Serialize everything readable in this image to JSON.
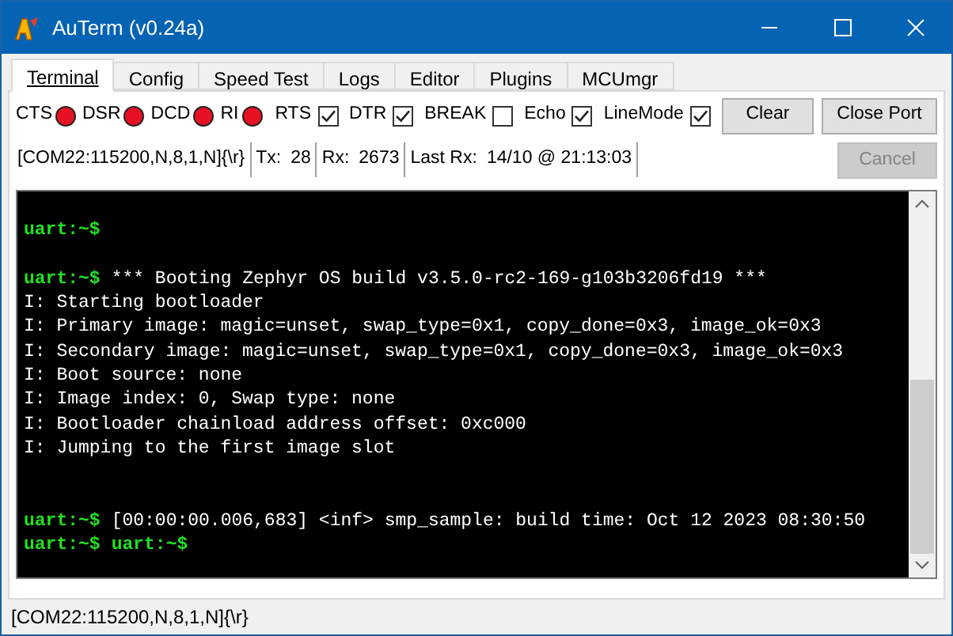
{
  "window": {
    "title": "AuTerm (v0.24a)"
  },
  "tabs": [
    {
      "label": "Terminal",
      "selected": true
    },
    {
      "label": "Config",
      "selected": false
    },
    {
      "label": "Speed Test",
      "selected": false
    },
    {
      "label": "Logs",
      "selected": false
    },
    {
      "label": "Editor",
      "selected": false
    },
    {
      "label": "Plugins",
      "selected": false
    },
    {
      "label": "MCUmgr",
      "selected": false
    }
  ],
  "indicators": [
    {
      "label": "CTS",
      "color": "#e81123"
    },
    {
      "label": "DSR",
      "color": "#e81123"
    },
    {
      "label": "DCD",
      "color": "#e81123"
    },
    {
      "label": "RI",
      "color": "#e81123"
    }
  ],
  "checkboxes": [
    {
      "label": "RTS",
      "checked": true
    },
    {
      "label": "DTR",
      "checked": true
    },
    {
      "label": "BREAK",
      "checked": false
    },
    {
      "label": "Echo",
      "checked": true
    },
    {
      "label": "LineMode",
      "checked": true
    }
  ],
  "buttons": [
    {
      "label": "Clear",
      "disabled": false
    },
    {
      "label": "Close Port",
      "disabled": false
    }
  ],
  "info_bar": [
    {
      "kind": "value",
      "text": "[COM22:115200,N,8,1,N]{\\r}"
    },
    {
      "kind": "label",
      "text": "Tx:"
    },
    {
      "kind": "value",
      "text": "28"
    },
    {
      "kind": "label",
      "text": "Rx:"
    },
    {
      "kind": "value",
      "text": "2673"
    },
    {
      "kind": "label",
      "text": "Last Rx:"
    },
    {
      "kind": "value",
      "text": "14/10 @ 21:13:03"
    }
  ],
  "cancel_button": {
    "label": "Cancel",
    "disabled": true
  },
  "terminal": [
    {
      "kind": "blank"
    },
    {
      "kind": "line",
      "segments": [
        {
          "kind": "prompt",
          "text": "uart:~$"
        }
      ]
    },
    {
      "kind": "blank"
    },
    {
      "kind": "line",
      "segments": [
        {
          "kind": "prompt",
          "text": "uart:~$"
        },
        {
          "kind": "text",
          "text": "*** Booting Zephyr OS build v3.5.0-rc2-169-g103b3206fd19 ***"
        }
      ]
    },
    {
      "kind": "line",
      "segments": [
        {
          "kind": "text",
          "text": "I: Starting bootloader"
        }
      ]
    },
    {
      "kind": "line",
      "segments": [
        {
          "kind": "text",
          "text": "I: Primary image: magic=unset, swap_type=0x1, copy_done=0x3, image_ok=0x3"
        }
      ]
    },
    {
      "kind": "line",
      "segments": [
        {
          "kind": "text",
          "text": "I: Secondary image: magic=unset, swap_type=0x1, copy_done=0x3, image_ok=0x3"
        }
      ]
    },
    {
      "kind": "line",
      "segments": [
        {
          "kind": "text",
          "text": "I: Boot source: none"
        }
      ]
    },
    {
      "kind": "line",
      "segments": [
        {
          "kind": "text",
          "text": "I: Image index: 0, Swap type: none"
        }
      ]
    },
    {
      "kind": "line",
      "segments": [
        {
          "kind": "text",
          "text": "I: Bootloader chainload address offset: 0xc000"
        }
      ]
    },
    {
      "kind": "line",
      "segments": [
        {
          "kind": "text",
          "text": "I: Jumping to the first image slot"
        }
      ]
    },
    {
      "kind": "blank"
    },
    {
      "kind": "blank"
    },
    {
      "kind": "line",
      "segments": [
        {
          "kind": "prompt",
          "text": "uart:~$"
        },
        {
          "kind": "text",
          "text": "[00:00:00.006,683] <inf> smp_sample: build time: Oct 12 2023 08:30:50"
        }
      ]
    },
    {
      "kind": "line",
      "segments": [
        {
          "kind": "prompt",
          "text": "uart:~$"
        },
        {
          "kind": "prompt",
          "text": "uart:~$"
        }
      ]
    }
  ],
  "status_bar": "[COM22:115200,N,8,1,N]{\\r}"
}
